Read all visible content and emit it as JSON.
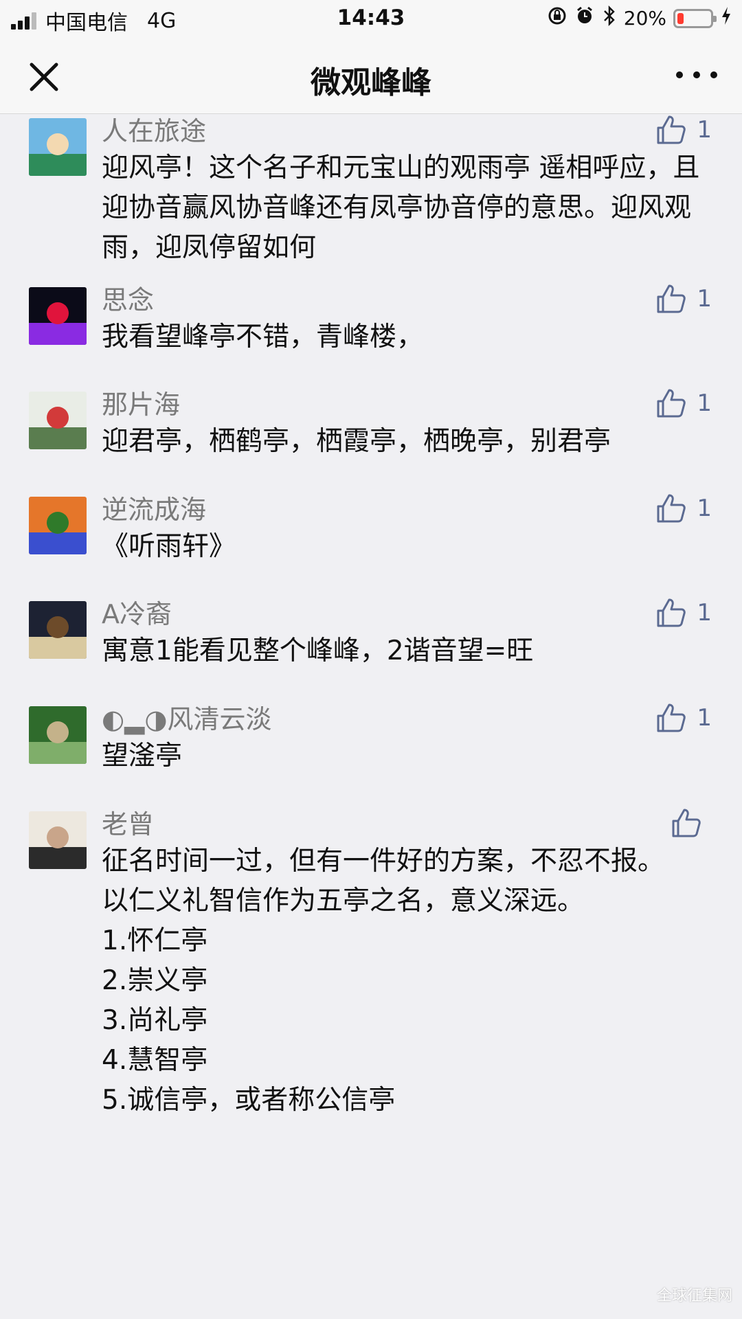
{
  "status_bar": {
    "carrier": "中国电信",
    "network": "4G",
    "time": "14:43",
    "battery_percent": "20%",
    "battery_level": 0.2,
    "icons": [
      "signal-icon",
      "orientation-lock-icon",
      "alarm-icon",
      "bluetooth-icon",
      "battery-icon",
      "charging-icon"
    ]
  },
  "nav": {
    "title": "微观峰峰",
    "close_icon": "close-icon",
    "more_icon": "more-icon"
  },
  "comments": [
    {
      "nickname": "人在旅途",
      "text": "迎风亭！这个名子和元宝山的观雨亭 遥相呼应，且迎协音赢风协音峰还有凤亭协音停的意思。迎风观雨，迎凤停留如何",
      "likes": "1",
      "avatar_colors": [
        "#6fb7e3",
        "#2e8c5a",
        "#f3d9b1"
      ]
    },
    {
      "nickname": "思念",
      "text": "我看望峰亭不错，青峰楼，",
      "likes": "1",
      "avatar_colors": [
        "#0b0b18",
        "#8a2be2",
        "#e0143c"
      ]
    },
    {
      "nickname": "那片海",
      "text": "迎君亭，栖鹤亭，栖霞亭，栖晚亭，别君亭",
      "likes": "1",
      "avatar_colors": [
        "#e9ede6",
        "#5a7d4f",
        "#d23a3a"
      ]
    },
    {
      "nickname": "逆流成海",
      "text": "《听雨轩》",
      "likes": "1",
      "avatar_colors": [
        "#e5762a",
        "#3a4fcf",
        "#2f7a2a"
      ]
    },
    {
      "nickname": "A冷裔",
      "text": "寓意1能看见整个峰峰，2谐音望=旺",
      "likes": "1",
      "avatar_colors": [
        "#1d2233",
        "#d9c9a0",
        "#6d4b2a"
      ]
    },
    {
      "nickname": "◐▂◑风清云淡",
      "text": "望滏亭",
      "likes": "1",
      "avatar_colors": [
        "#2f6b2c",
        "#7fae6a",
        "#c4b28a"
      ]
    },
    {
      "nickname": "老曾",
      "text": "征名时间一过，但有一件好的方案，不忍不报。\n以仁义礼智信作为五亭之名，意义深远。\n1.怀仁亭\n2.崇义亭\n3.尚礼亭\n4.慧智亭\n5.诚信亭，或者称公信亭",
      "likes": "",
      "avatar_colors": [
        "#ede8df",
        "#2b2b2b",
        "#c9a58a"
      ]
    }
  ],
  "watermark": "全球征集网"
}
